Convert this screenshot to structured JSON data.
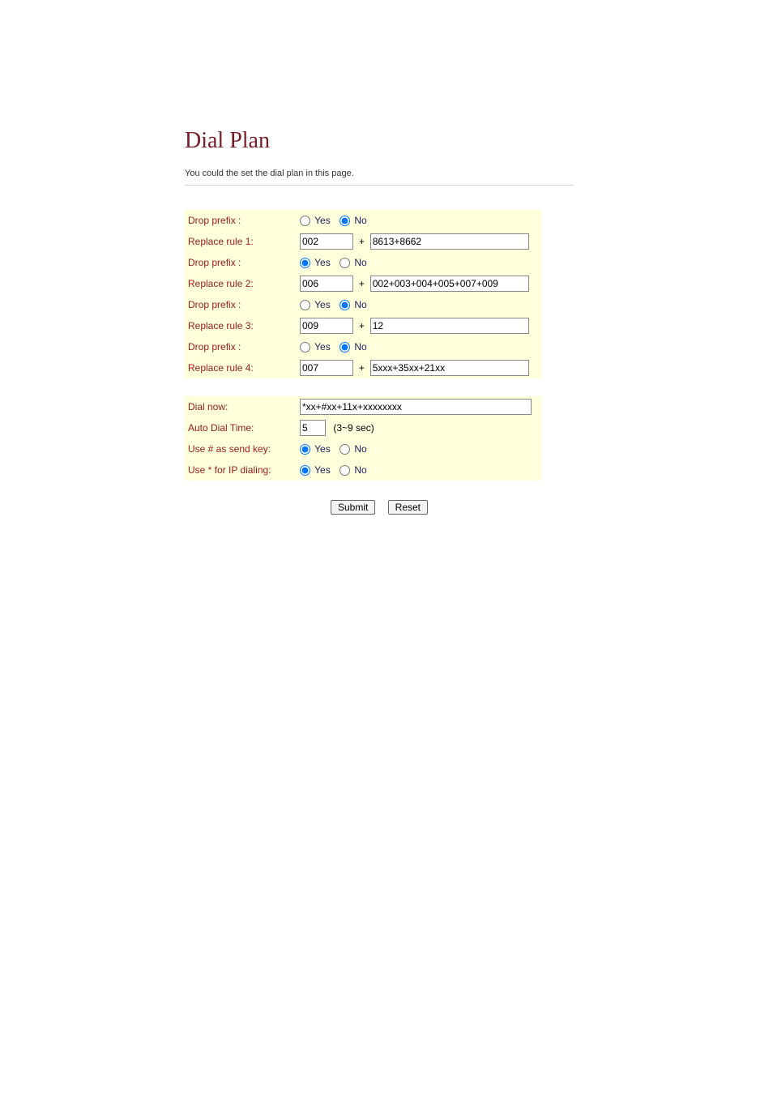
{
  "page": {
    "title": "Dial Plan",
    "description": "You could the set the dial plan in this page."
  },
  "labels": {
    "drop_prefix": "Drop prefix :",
    "replace_rule_1": "Replace rule 1:",
    "replace_rule_2": "Replace rule 2:",
    "replace_rule_3": "Replace rule 3:",
    "replace_rule_4": "Replace rule 4:",
    "dial_now": "Dial now:",
    "auto_dial_time": "Auto Dial Time:",
    "use_hash_send_key": "Use # as send key:",
    "use_star_ip_dialing": "Use * for IP dialing:",
    "yes": "Yes",
    "no": "No",
    "plus": "+",
    "adt_range": "(3~9 sec)"
  },
  "values": {
    "rule1": {
      "drop_prefix": "no",
      "prefix": "002",
      "rule": "8613+8662"
    },
    "rule2": {
      "drop_prefix": "yes",
      "prefix": "006",
      "rule": "002+003+004+005+007+009"
    },
    "rule3": {
      "drop_prefix": "no",
      "prefix": "009",
      "rule": "12"
    },
    "rule4": {
      "drop_prefix": "no",
      "prefix": "007",
      "rule": "5xxx+35xx+21xx"
    },
    "dial_now": "*xx+#xx+11x+xxxxxxxx",
    "auto_dial_time": "5",
    "hash_send_key": "yes",
    "star_ip_dialing": "yes"
  },
  "buttons": {
    "submit": "Submit",
    "reset": "Reset"
  }
}
